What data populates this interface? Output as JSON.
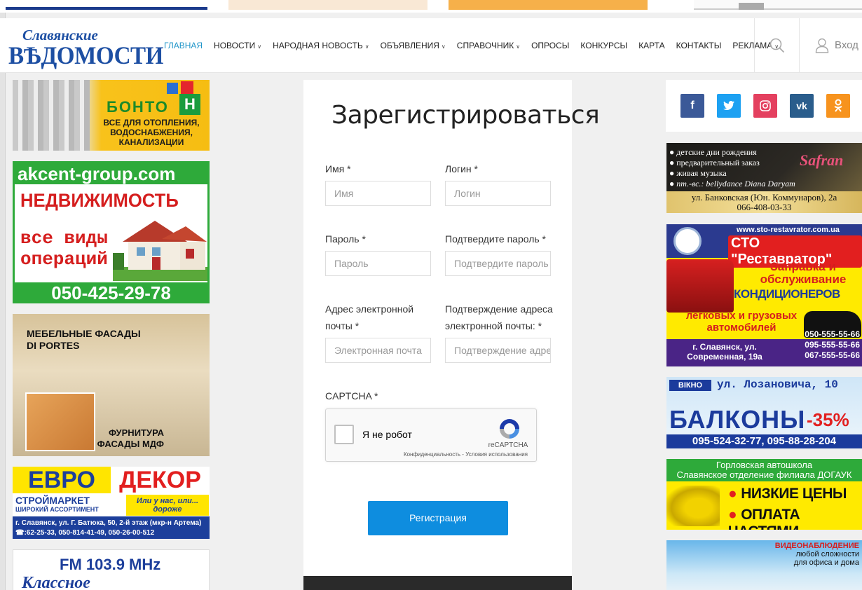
{
  "site": {
    "logo_top": "Славянские",
    "logo_bottom": "ВѢДОМОСТИ"
  },
  "nav": {
    "items": [
      {
        "label": "ГЛАВНАЯ",
        "active": true,
        "dropdown": false
      },
      {
        "label": "НОВОСТИ",
        "active": false,
        "dropdown": true
      },
      {
        "label": "НАРОДНАЯ НОВОСТЬ",
        "active": false,
        "dropdown": true
      },
      {
        "label": "ОБЪЯВЛЕНИЯ",
        "active": false,
        "dropdown": true
      },
      {
        "label": "СПРАВОЧНИК",
        "active": false,
        "dropdown": true
      },
      {
        "label": "ОПРОСЫ",
        "active": false,
        "dropdown": false
      },
      {
        "label": "КОНКУРСЫ",
        "active": false,
        "dropdown": false
      },
      {
        "label": "КАРТА",
        "active": false,
        "dropdown": false
      },
      {
        "label": "КОНТАКТЫ",
        "active": false,
        "dropdown": false
      },
      {
        "label": "РЕКЛАМА",
        "active": false,
        "dropdown": true
      }
    ],
    "search_icon": "search-icon",
    "login_label": "Вход",
    "login_icon": "user-icon",
    "active_color": "#2196c9"
  },
  "form": {
    "title": "Зарегистрироваться",
    "fields": {
      "name": {
        "label": "Имя *",
        "placeholder": "Имя"
      },
      "login": {
        "label": "Логин *",
        "placeholder": "Логин"
      },
      "password": {
        "label": "Пароль *",
        "placeholder": "Пароль"
      },
      "password_confirm": {
        "label": "Подтвердите пароль *",
        "placeholder": "Подтвердите пароль"
      },
      "email": {
        "label_line1": "Адрес электронной",
        "label_line2": "почты *",
        "placeholder": "Электронная почта"
      },
      "email_confirm": {
        "label_line1": "Подтверждение адреса",
        "label_line2": "электронной почты: *",
        "placeholder": "Подтверждение адреса"
      }
    },
    "captcha": {
      "label": "CAPTCHA *",
      "checkbox_label": "Я не робот",
      "brand": "reCAPTCHA",
      "terms": "Конфиденциальность - Условия использования"
    },
    "submit_label": "Регистрация",
    "submit_color": "#0e8ddf"
  },
  "social": [
    {
      "name": "facebook",
      "glyph": "f",
      "color": "#3b5998"
    },
    {
      "name": "twitter",
      "glyph": "t",
      "color": "#1da1f2"
    },
    {
      "name": "instagram",
      "glyph": "◎",
      "color": "#e4405f"
    },
    {
      "name": "vk",
      "glyph": "vk",
      "color": "#2a5d8c"
    },
    {
      "name": "odnoklassniki",
      "glyph": "ок",
      "color": "#f7931e"
    }
  ],
  "ads_left": {
    "bonton": {
      "brand": "БОНТО",
      "brand_h": "Н",
      "text": "ВСЕ ДЛЯ ОТОПЛЕНИЯ, ВОДОСНАБЖЕНИЯ, КАНАЛИЗАЦИИ"
    },
    "akcent": {
      "site": "akcent-group.com",
      "title": "НЕДВИЖИМОСТЬ",
      "sub": "все виды операций",
      "phone": "050-425-29-78"
    },
    "diportes": {
      "line1": "МЕБЕЛЬНЫЕ ФАСАДЫ",
      "line2": "DI PORTES",
      "line3": "ФУРНИТУРА",
      "line4": "ФАСАДЫ МДФ"
    },
    "evrodekor": {
      "evro": "ЕВРО",
      "dekor": "ДЕКОР",
      "store": "СТРОЙМАРКЕТ",
      "assort": "ШИРОКИЙ АССОРТИМЕНТ",
      "slogan": "Или у нас, или... дороже",
      "addr": "г. Славянск, ул. Г. Батюка, 50, 2-й этаж (мкр-н Артема)",
      "phones": "☎:62-25-33, 050-814-41-49, 050-26-00-512"
    },
    "radio": {
      "freq": "FM 103.9 MHz",
      "name": "Классное"
    }
  },
  "ads_right": {
    "safran": {
      "items": [
        "● детские дни рождения",
        "● предварительный заказ",
        "● живая музыка",
        "● пт.-вс.: bellydance Diana Daryam"
      ],
      "brand": "Safran",
      "addr": "ул. Банковская (Юн. Коммунаров), 2а",
      "phone": "066-408-03-33"
    },
    "sto": {
      "url": "www.sto-restavrator.com.ua",
      "name": "СТО \"Реставратор\"",
      "l1": "Заправка и обслуживание",
      "l2": "КОНДИЦИОНЕРОВ",
      "l3": "легковых и грузовых автомобилей",
      "addr": "г. Славянск, ул. Современная, 19а",
      "phones": [
        "050-555-55-66",
        "095-555-55-66",
        "067-555-55-66"
      ]
    },
    "vikno": {
      "brand": "ВІКНО",
      "street": "ул. Лозановича, 10",
      "title": "БАЛКОНЫ",
      "discount": "-35%",
      "phones": "095-524-32-77,  095-88-28-204"
    },
    "autoschool": {
      "h1": "Горловская автошкола",
      "h2": "Славянское отделение филиала ДОГАУК",
      "i1": "НИЗКИЕ ЦЕНЫ",
      "i2": "ОПЛАТА ЧАСТЯМИ"
    },
    "video": {
      "t1": "ВИДЕОНАБЛЮДЕНИЕ",
      "t2": "любой сложности",
      "t3": "для офиса и дома"
    }
  }
}
